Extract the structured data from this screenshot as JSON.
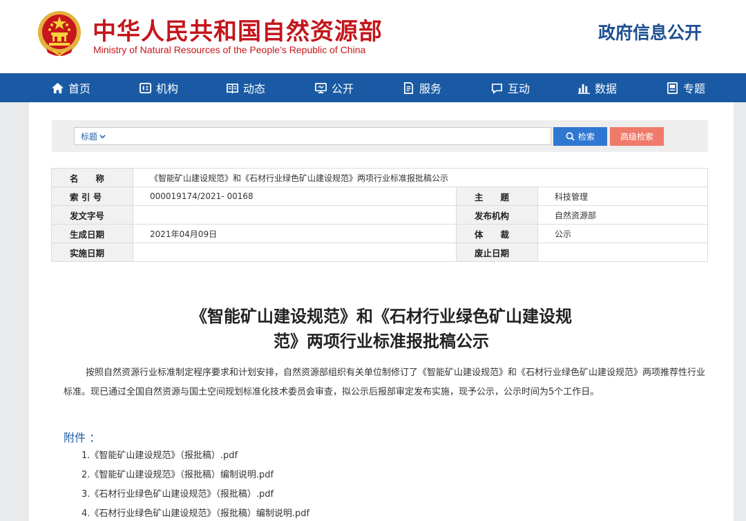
{
  "header": {
    "title_cn": "中华人民共和国自然资源部",
    "title_en": "Ministry of Natural Resources of the People’s Republic of China",
    "section": "政府信息公开"
  },
  "nav": {
    "items": [
      {
        "label": "首页",
        "icon": "home-icon"
      },
      {
        "label": "机构",
        "icon": "org-icon"
      },
      {
        "label": "动态",
        "icon": "news-icon"
      },
      {
        "label": "公开",
        "icon": "monitor-icon"
      },
      {
        "label": "服务",
        "icon": "document-icon"
      },
      {
        "label": "互动",
        "icon": "chat-icon"
      },
      {
        "label": "数据",
        "icon": "bar-chart-icon"
      },
      {
        "label": "专题",
        "icon": "book-icon"
      }
    ]
  },
  "search": {
    "field_label": "标题",
    "value": "",
    "search_label": "检索",
    "advanced_label": "高级检索"
  },
  "meta": {
    "name_key": "名　　称",
    "name_value": "《智能矿山建设规范》和《石材行业绿色矿山建设规范》两项行业标准报批稿公示",
    "index_key": "索 引 号",
    "index_value": "000019174/2021- 00168",
    "topic_key": "主　　题",
    "topic_value": "科技管理",
    "docno_key": "发文字号",
    "docno_value": "",
    "publisher_key": "发布机构",
    "publisher_value": "自然资源部",
    "date_key": "生成日期",
    "date_value": "2021年04月09日",
    "genre_key": "体　　裁",
    "genre_value": "公示",
    "effective_key": "实施日期",
    "effective_value": "",
    "expiry_key": "废止日期",
    "expiry_value": ""
  },
  "article": {
    "title_line1": "《智能矿山建设规范》和《石材行业绿色矿山建设规",
    "title_line2": "范》两项行业标准报批稿公示",
    "body": "按照自然资源行业标准制定程序要求和计划安排，自然资源部组织有关单位制修订了《智能矿山建设规范》和《石材行业绿色矿山建设规范》两项推荐性行业标准。现已通过全国自然资源与国土空间规划标准化技术委员会审查，拟公示后报部审定发布实施，现予公示，公示时间为5个工作日。",
    "attach_label": "附件 ：",
    "attachments": [
      "1.《智能矿山建设规范》（报批稿）.pdf",
      "2.《智能矿山建设规范》（报批稿）编制说明.pdf",
      "3.《石材行业绿色矿山建设规范》（报批稿）.pdf",
      "4.《石材行业绿色矿山建设规范》（报批稿）编制说明.pdf"
    ]
  },
  "colors": {
    "brand_red": "#c4161c",
    "nav_blue": "#1a5aa4",
    "search_blue": "#2f77d1",
    "advanced_salmon": "#ef7a6a"
  }
}
